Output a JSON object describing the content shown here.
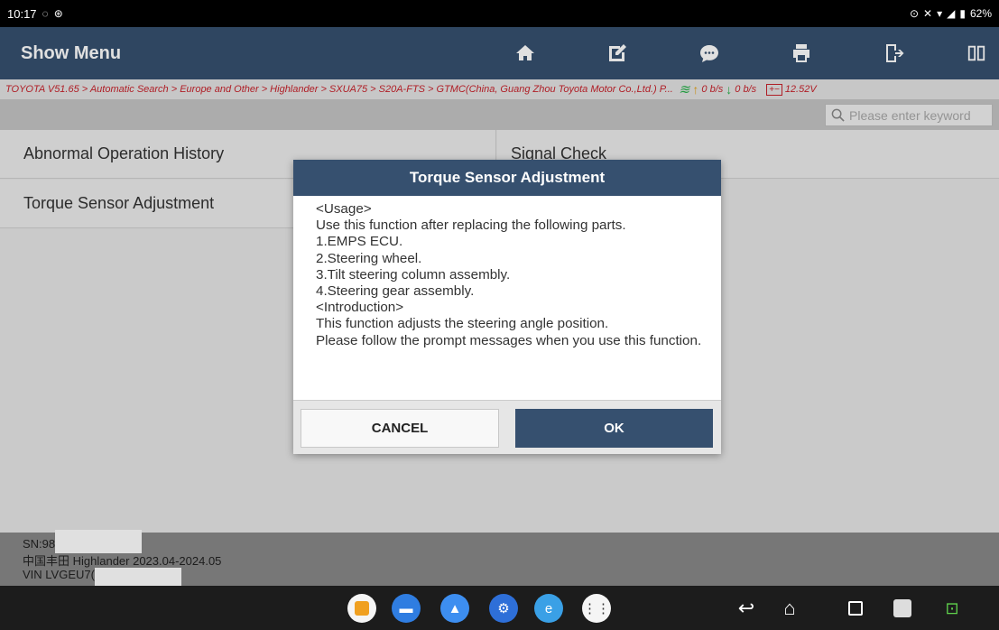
{
  "status_bar": {
    "time": "10:17",
    "battery": "62%"
  },
  "header": {
    "title": "Show Menu",
    "toolbar_icons": [
      "home-icon",
      "edit-icon",
      "message-icon",
      "print-icon",
      "exit-icon",
      "split-view-icon"
    ]
  },
  "breadcrumb": {
    "path": "TOYOTA V51.65 > Automatic Search > Europe and Other > Highlander > SXUA75 > S20A-FTS > GTMC(China, Guang Zhou Toyota Motor Co.,Ltd.) P...",
    "upload_rate": "0 b/s",
    "download_rate": "0 b/s",
    "voltage": "12.52V"
  },
  "search": {
    "placeholder": "Please enter keyword"
  },
  "menu": {
    "items": [
      {
        "label": "Abnormal Operation History"
      },
      {
        "label": "Signal Check"
      },
      {
        "label": "Torque Sensor Adjustment"
      }
    ]
  },
  "footer": {
    "sn_prefix": "SN:98",
    "vehicle": "中国丰田 Highlander 2023.04-2024.05",
    "vin_prefix": "VIN LVGEU7("
  },
  "dialog": {
    "title": "Torque Sensor Adjustment",
    "lines": [
      "<Usage>",
      "Use this function after replacing the following parts.",
      "1.EMPS ECU.",
      "2.Steering wheel.",
      "3.Tilt steering column assembly.",
      "4.Steering gear assembly.",
      "<Introduction>",
      "This function adjusts the steering angle position.",
      "Please follow the prompt messages when you use this function."
    ],
    "cancel_label": "CANCEL",
    "ok_label": "OK"
  },
  "dock": {
    "apps": [
      "recorder-icon",
      "files-icon",
      "gallery-icon",
      "settings-icon",
      "browser-icon",
      "app-drawer-icon"
    ],
    "nav": [
      "back-icon",
      "home-nav-icon",
      "recents-icon"
    ],
    "extras": [
      "screenshot-icon",
      "vci-icon"
    ]
  },
  "colors": {
    "header_bg": "#36506f",
    "breadcrumb_text": "#c8232c",
    "ok_button": "#36506f"
  }
}
